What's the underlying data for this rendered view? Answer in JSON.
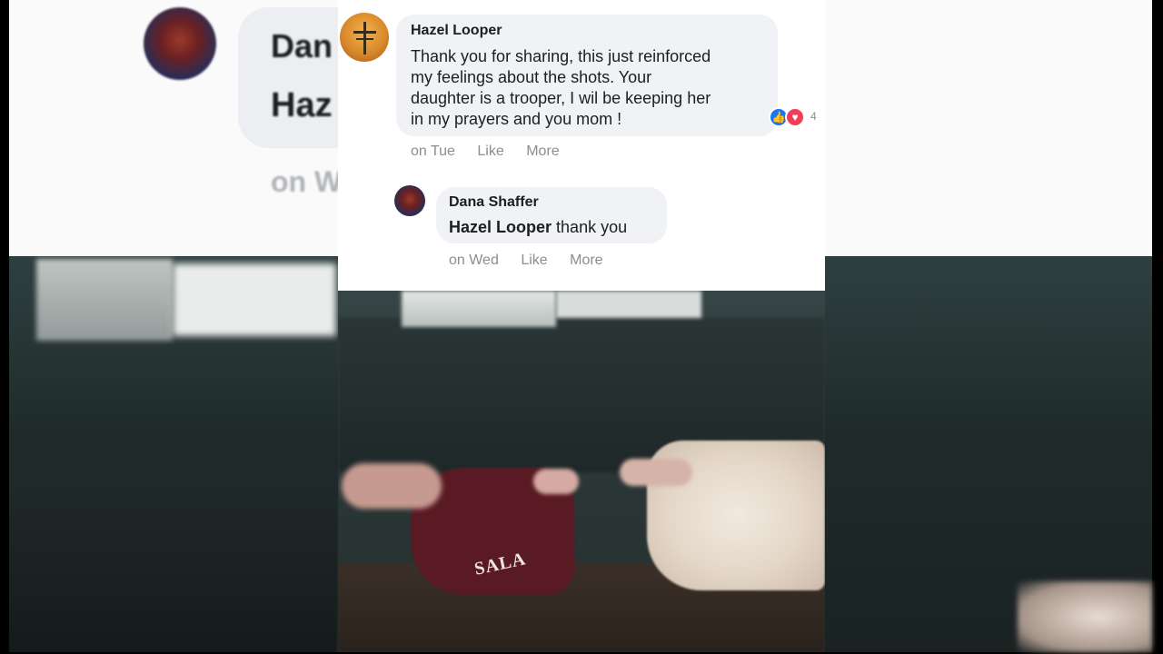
{
  "background": {
    "comment": {
      "name": "Dan",
      "mention": "Haz",
      "meta": "on W"
    }
  },
  "comments": [
    {
      "author": "Hazel Looper",
      "text_lines": [
        "Thank you for sharing, this just reinforced",
        "my feelings about the shots. Your",
        "daughter is a trooper, I wil be keeping her",
        "in my prayers and you mom !"
      ],
      "time": "on Tue",
      "like_label": "Like",
      "more_label": "More",
      "reaction_count": "4"
    },
    {
      "author": "Dana Shaffer",
      "mention": "Hazel Looper",
      "text": "thank you",
      "time": "on Wed",
      "like_label": "Like",
      "more_label": "More"
    }
  ],
  "video": {
    "shirt_text": "SALA"
  },
  "colors": {
    "bubble": "#f0f2f5",
    "meta": "#8a8d91",
    "like_blue": "#1877f2",
    "love_red": "#f33e58"
  }
}
